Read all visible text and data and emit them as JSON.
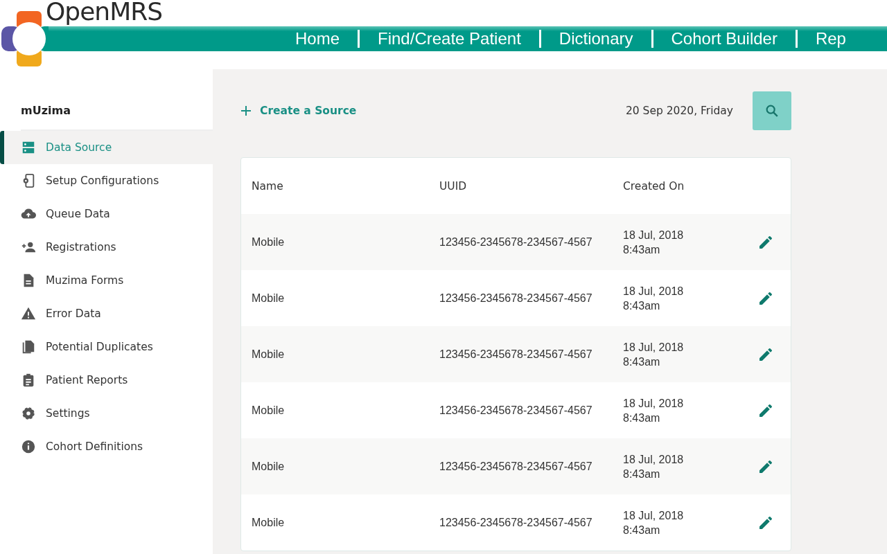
{
  "brand": {
    "name": "OpenMRS"
  },
  "nav": [
    {
      "label": "Home"
    },
    {
      "label": "Find/Create Patient"
    },
    {
      "label": "Dictionary"
    },
    {
      "label": "Cohort Builder"
    },
    {
      "label": "Rep"
    }
  ],
  "sidebar": {
    "title": "mUzima",
    "items": [
      {
        "label": "Data Source",
        "selected": true
      },
      {
        "label": "Setup Configurations",
        "selected": false
      },
      {
        "label": "Queue Data",
        "selected": false
      },
      {
        "label": "Registrations",
        "selected": false
      },
      {
        "label": "Muzima Forms",
        "selected": false
      },
      {
        "label": "Error Data",
        "selected": false
      },
      {
        "label": "Potential Duplicates",
        "selected": false
      },
      {
        "label": "Patient Reports",
        "selected": false
      },
      {
        "label": "Settings",
        "selected": false
      },
      {
        "label": "Cohort Definitions",
        "selected": false
      }
    ]
  },
  "toolbar": {
    "create_label": "Create a Source",
    "date": "20 Sep 2020, Friday"
  },
  "table": {
    "columns": [
      "Name",
      "UUID",
      "Created On"
    ],
    "rows": [
      {
        "name": "Mobile",
        "uuid": "123456-2345678-234567-4567",
        "created_date": "18 Jul, 2018",
        "created_time": "8:43am"
      },
      {
        "name": "Mobile",
        "uuid": "123456-2345678-234567-4567",
        "created_date": "18 Jul, 2018",
        "created_time": "8:43am"
      },
      {
        "name": "Mobile",
        "uuid": "123456-2345678-234567-4567",
        "created_date": "18 Jul, 2018",
        "created_time": "8:43am"
      },
      {
        "name": "Mobile",
        "uuid": "123456-2345678-234567-4567",
        "created_date": "18 Jul, 2018",
        "created_time": "8:43am"
      },
      {
        "name": "Mobile",
        "uuid": "123456-2345678-234567-4567",
        "created_date": "18 Jul, 2018",
        "created_time": "8:43am"
      },
      {
        "name": "Mobile",
        "uuid": "123456-2345678-234567-4567",
        "created_date": "18 Jul, 2018",
        "created_time": "8:43am"
      }
    ]
  }
}
